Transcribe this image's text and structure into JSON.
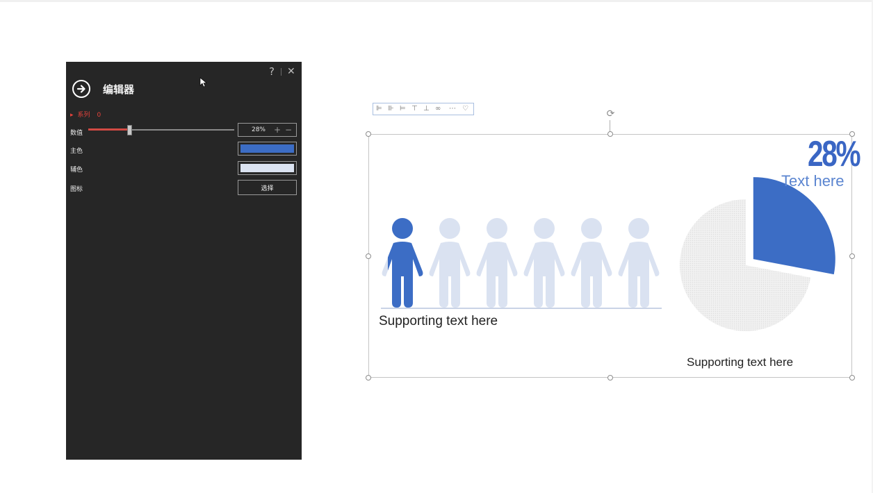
{
  "panel": {
    "help_icon": "?",
    "close_icon": "✕",
    "back_icon": "arrow-right-circle-icon",
    "title": "编辑器",
    "series_label": "系列",
    "series_value": "0",
    "rows": {
      "percent_label": "数值",
      "main_color_label": "主色",
      "sub_color_label": "辅色",
      "icon_label": "图标"
    },
    "percent_value": 0.28,
    "percent_display": "28%",
    "plus_glyph": "+",
    "minus_glyph": "−",
    "choose_button": "选择",
    "main_color": "#3c6dc5",
    "sub_color": "#dbe3f1"
  },
  "slide": {
    "big_percent": "28%",
    "text_here": "Text here",
    "support_left": "Supporting text here",
    "support_right": "Supporting text here",
    "people_total": 6,
    "people_filled_fraction": 0.28,
    "pie_value": 0.28,
    "colors": {
      "primary": "#3c6dc5",
      "light": "#dae2f1",
      "pie_rest": "#ececec"
    },
    "mini_toolbar_icons": [
      "align-left-icon",
      "align-center-icon",
      "align-right-icon",
      "align-top-icon",
      "align-middle-icon",
      "link-icon",
      "more-icon",
      "heart-icon"
    ]
  }
}
